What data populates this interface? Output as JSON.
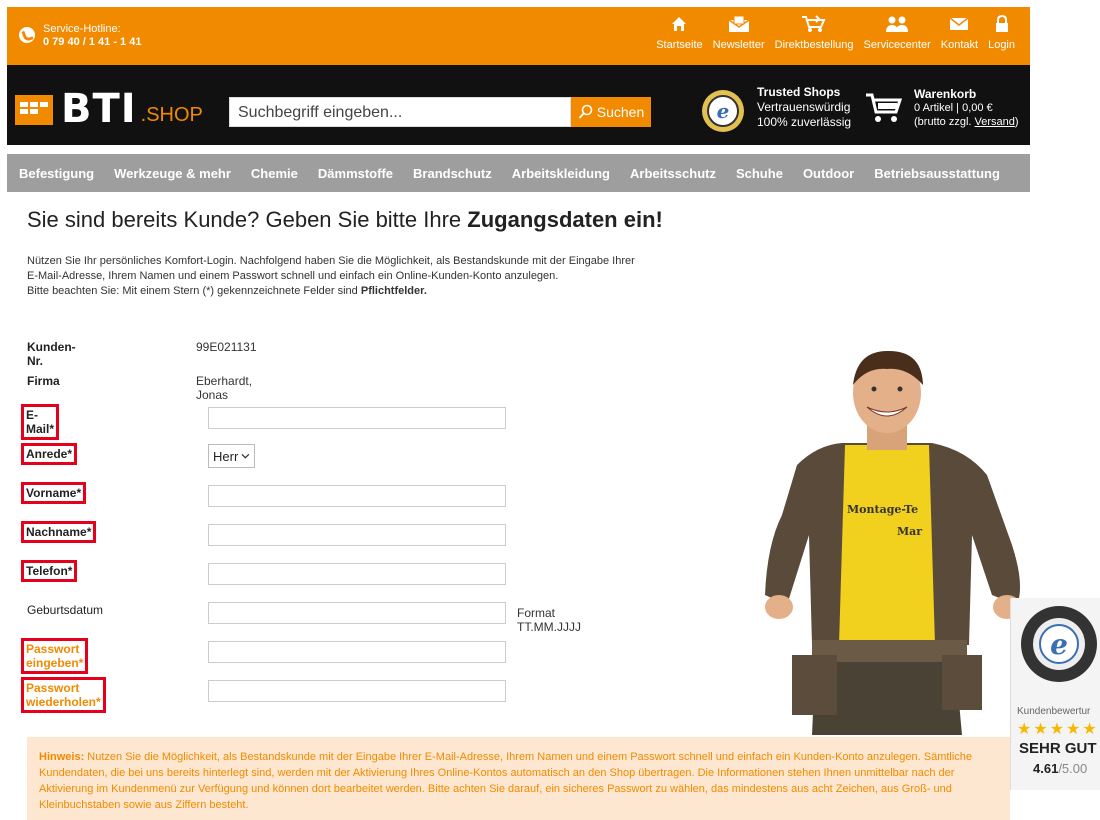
{
  "topbar": {
    "hotline_label": "Service-Hotline:",
    "hotline_number": "0 79 40 / 1 41 - 1 41",
    "nav": [
      {
        "label": "Startseite",
        "icon": "home-icon"
      },
      {
        "label": "Newsletter",
        "icon": "newsletter-icon"
      },
      {
        "label": "Direktbestellung",
        "icon": "direct-order-icon"
      },
      {
        "label": "Servicecenter",
        "icon": "people-icon"
      },
      {
        "label": "Kontakt",
        "icon": "mail-icon"
      },
      {
        "label": "Login",
        "icon": "lock-icon"
      }
    ]
  },
  "header": {
    "logo_text": "BTI",
    "logo_suffix": ".SHOP",
    "search_placeholder": "Suchbegriff eingeben...",
    "search_button": "Suchen",
    "trusted_title": "Trusted Shops",
    "trusted_line1": "Vertrauenswürdig",
    "trusted_line2": "100% zuverlässig",
    "cart_title": "Warenkorb",
    "cart_summary": "0 Artikel | 0,00 €",
    "cart_note_prefix": "(brutto zzgl. ",
    "cart_note_link": "Versand",
    "cart_note_suffix": ")"
  },
  "categories": [
    "Befestigung",
    "Werkzeuge & mehr",
    "Chemie",
    "Dämmstoffe",
    "Brandschutz",
    "Arbeitskleidung",
    "Arbeitsschutz",
    "Schuhe",
    "Outdoor",
    "Betriebsausstattung"
  ],
  "page": {
    "title_plain": "Sie sind bereits Kunde? Geben Sie bitte Ihre ",
    "title_bold": "Zugangsdaten ein!",
    "intro_line1": "Nützen Sie Ihr persönliches Komfort-Login. Nachfolgend haben Sie die Möglichkeit, als Bestandskunde mit der Eingabe Ihrer",
    "intro_line2": "E-Mail-Adresse, Ihrem Namen und einem Passwort schnell und einfach ein Online-Kunden-Konto anzulegen.",
    "intro_line3_plain": "Bitte beachten Sie: Mit einem Stern (*) gekennzeichnete Felder sind ",
    "intro_line3_bold": "Pflichtfelder."
  },
  "form": {
    "kundennr_label": "Kunden-Nr.",
    "kundennr_value": "99E021131",
    "firma_label": "Firma",
    "firma_value": "Eberhardt, Jonas",
    "email_label": "E-Mail*",
    "anrede_label": "Anrede*",
    "anrede_value": "Herr",
    "vorname_label": "Vorname*",
    "nachname_label": "Nachname*",
    "telefon_label": "Telefon*",
    "geburtsdatum_label": "Geburtsdatum",
    "geburtsdatum_format": "Format TT.MM.JJJJ",
    "passwort_label": "Passwort eingeben*",
    "passwort2_label": "Passwort wiederholen*"
  },
  "photo": {
    "shirt_text1": "Montage-Te",
    "shirt_text2": "Mar"
  },
  "trusted_widget": {
    "label": "Kundenbewertur",
    "stars": "★★★★★",
    "grade": "SEHR GUT",
    "score": "4.61",
    "score_max": "/5.00"
  },
  "hint": {
    "label": "Hinweis:",
    "text": " Nutzen Sie die Möglichkeit, als Bestandskunde mit der Eingabe Ihrer E-Mail-Adresse, Ihrem Namen und einem Passwort schnell und einfach ein Kunden-Konto anzulegen. Sämtliche Kundendaten, die bei uns bereits hinterlegt sind, werden mit der Aktivierung Ihres Online-Kontos automatisch an den Shop übertragen. Die Informationen stehen Ihnen unmittelbar nach der Aktivierung im Kundenmenü zur Verfügung und können dort bearbeitet werden. Bitte achten Sie darauf, ein sicheres Passwort zu wählen, das mindestens aus acht Zeichen, aus Groß- und Kleinbuchstaben sowie aus Ziffern besteht."
  },
  "colors": {
    "accent": "#f28a00",
    "header_bg": "#111111",
    "nav_bg": "#9e9e9e",
    "highlight": "#e5001c",
    "hint_bg": "#fde7d0"
  }
}
